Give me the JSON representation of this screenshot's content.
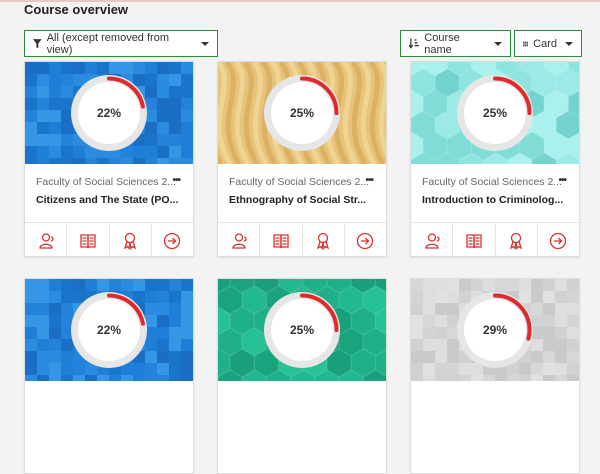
{
  "header": {
    "title": "Course overview",
    "filter_label": "All (except removed from view)",
    "sort_label": "Course name",
    "view_label": "Card"
  },
  "colors": {
    "accent_green": "#2e8b3c",
    "progress_red": "#e0292c",
    "action_icon_red": "#d9312f"
  },
  "courses": [
    {
      "category": "Faculty of Social Sciences 2...",
      "name": "Citizens and The State (PO...",
      "progress": "22%",
      "progress_value": 0.22,
      "image": "blue-mosaic"
    },
    {
      "category": "Faculty of Social Sciences 2...",
      "name": "Ethnography of Social Str...",
      "progress": "25%",
      "progress_value": 0.25,
      "image": "gold-waves"
    },
    {
      "category": "Faculty of Social Sciences 2...",
      "name": "Introduction to Criminolog...",
      "progress": "25%",
      "progress_value": 0.25,
      "image": "teal-hexagons"
    },
    {
      "category": "",
      "name": "",
      "progress": "22%",
      "progress_value": 0.22,
      "image": "blue-mosaic"
    },
    {
      "category": "",
      "name": "",
      "progress": "25%",
      "progress_value": 0.25,
      "image": "green-hexagons"
    },
    {
      "category": "",
      "name": "",
      "progress": "29%",
      "progress_value": 0.29,
      "image": "grey-mosaic"
    }
  ],
  "card_actions": [
    "participants-icon",
    "grades-icon",
    "badges-icon",
    "go-to-course-icon"
  ]
}
